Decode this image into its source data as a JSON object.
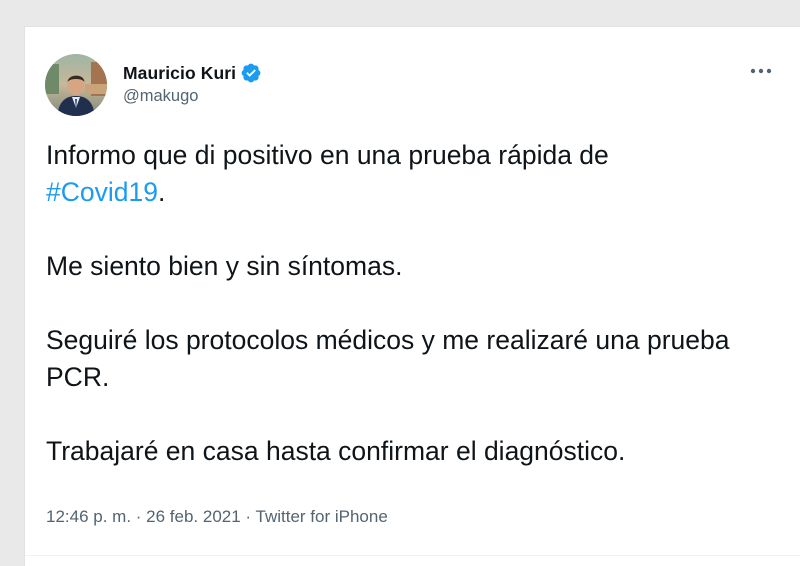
{
  "author": {
    "name": "Mauricio Kuri",
    "handle": "@makugo",
    "verified": true,
    "avatar_icon": "profile-photo"
  },
  "tweet": {
    "line1_text": "Informo que di positivo en una prueba rápida de",
    "hashtag": "#Covid19",
    "hashtag_suffix": ".",
    "para2": "Me siento bien y sin síntomas.",
    "para3": "Seguiré los protocolos médicos y me realizaré una prueba PCR.",
    "para4": "Trabajaré en casa hasta confirmar el diagnóstico."
  },
  "meta": {
    "time": "12:46 p. m.",
    "separator1": " · ",
    "date": "26 feb. 2021",
    "separator2": " · ",
    "source": "Twitter for iPhone"
  },
  "colors": {
    "link": "#1d9bf0",
    "text": "#0f1419",
    "muted": "#536471",
    "verified_badge": "#1d9bf0"
  },
  "icons": {
    "verified": "verified-badge-icon",
    "more": "more-horizontal-icon"
  }
}
